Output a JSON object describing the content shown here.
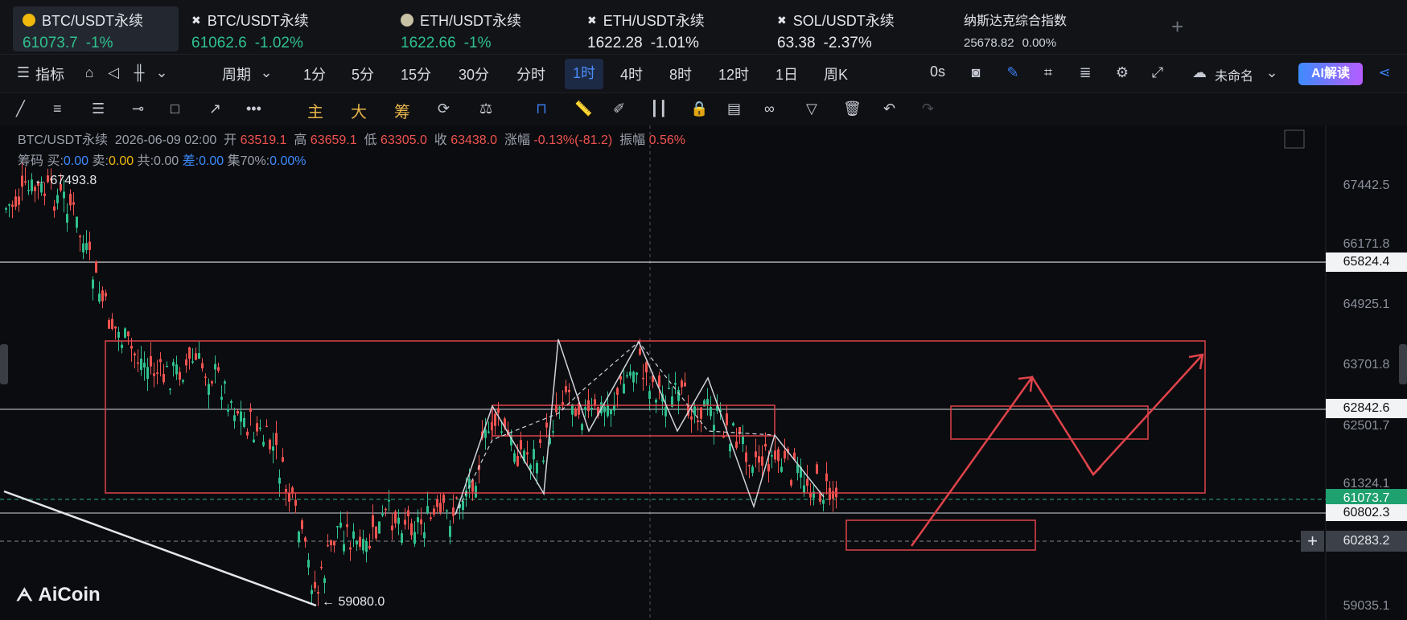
{
  "tickers": [
    {
      "name": "BTC/USDT永续",
      "price": "61073.7",
      "change": "-1%",
      "active": true
    },
    {
      "name": "BTC/USDT永续",
      "price": "61062.6",
      "change": "-1.02%"
    },
    {
      "name": "ETH/USDT永续",
      "price": "1622.66",
      "change": "-1%"
    },
    {
      "name": "ETH/USDT永续",
      "price": "1622.28",
      "change": "-1.01%"
    },
    {
      "name": "SOL/USDT永续",
      "price": "63.38",
      "change": "-2.37%"
    },
    {
      "name": "纳斯达克综合指数",
      "price": "25678.82",
      "change": "0.00%"
    }
  ],
  "toolbar": {
    "indicator": "指标",
    "period": "周期",
    "intervals": [
      "1分",
      "5分",
      "15分",
      "30分",
      "分时",
      "1时",
      "4时",
      "8时",
      "12时",
      "1日",
      "周K"
    ],
    "active_interval": "1时",
    "countdown": "0s",
    "layout_name": "未命名",
    "ai": "AI解读"
  },
  "drawbar": {
    "main": "主",
    "big": "大",
    "chip": "筹"
  },
  "info": {
    "symbol": "BTC/USDT永续",
    "datetime": "2026-06-09 02:00",
    "open_label": "开",
    "open": "63519.1",
    "high_label": "高",
    "high": "63659.1",
    "low_label": "低",
    "low": "63305.0",
    "close_label": "收",
    "close": "63438.0",
    "change_label": "涨幅",
    "change": "-0.13%(-81.2)",
    "amp_label": "振幅",
    "amp": "0.56%",
    "chip_label": "筹码",
    "buy_label": "买:",
    "buy": "0.00",
    "sell_label": "卖:",
    "sell": "0.00",
    "total_label": "共:",
    "total": "0.00",
    "diff_label": "差:",
    "diff": "0.00",
    "set_label": "集70%:",
    "set": "0.00%"
  },
  "price_axis": [
    "67442.5",
    "66171.8",
    "64925.1",
    "63701.8",
    "62501.7",
    "61324.1",
    "59035.1"
  ],
  "price_labels": {
    "l1": "65824.4",
    "l2": "62842.6",
    "current": "61073.7",
    "l3": "60802.3",
    "cross": "60283.2"
  },
  "annotations": {
    "high": "67493.8",
    "low": "59080.0"
  },
  "logo": "AiCoin",
  "colors": {
    "up": "#2fc08e",
    "down": "#ef5350",
    "accent": "#3a7ff2"
  }
}
